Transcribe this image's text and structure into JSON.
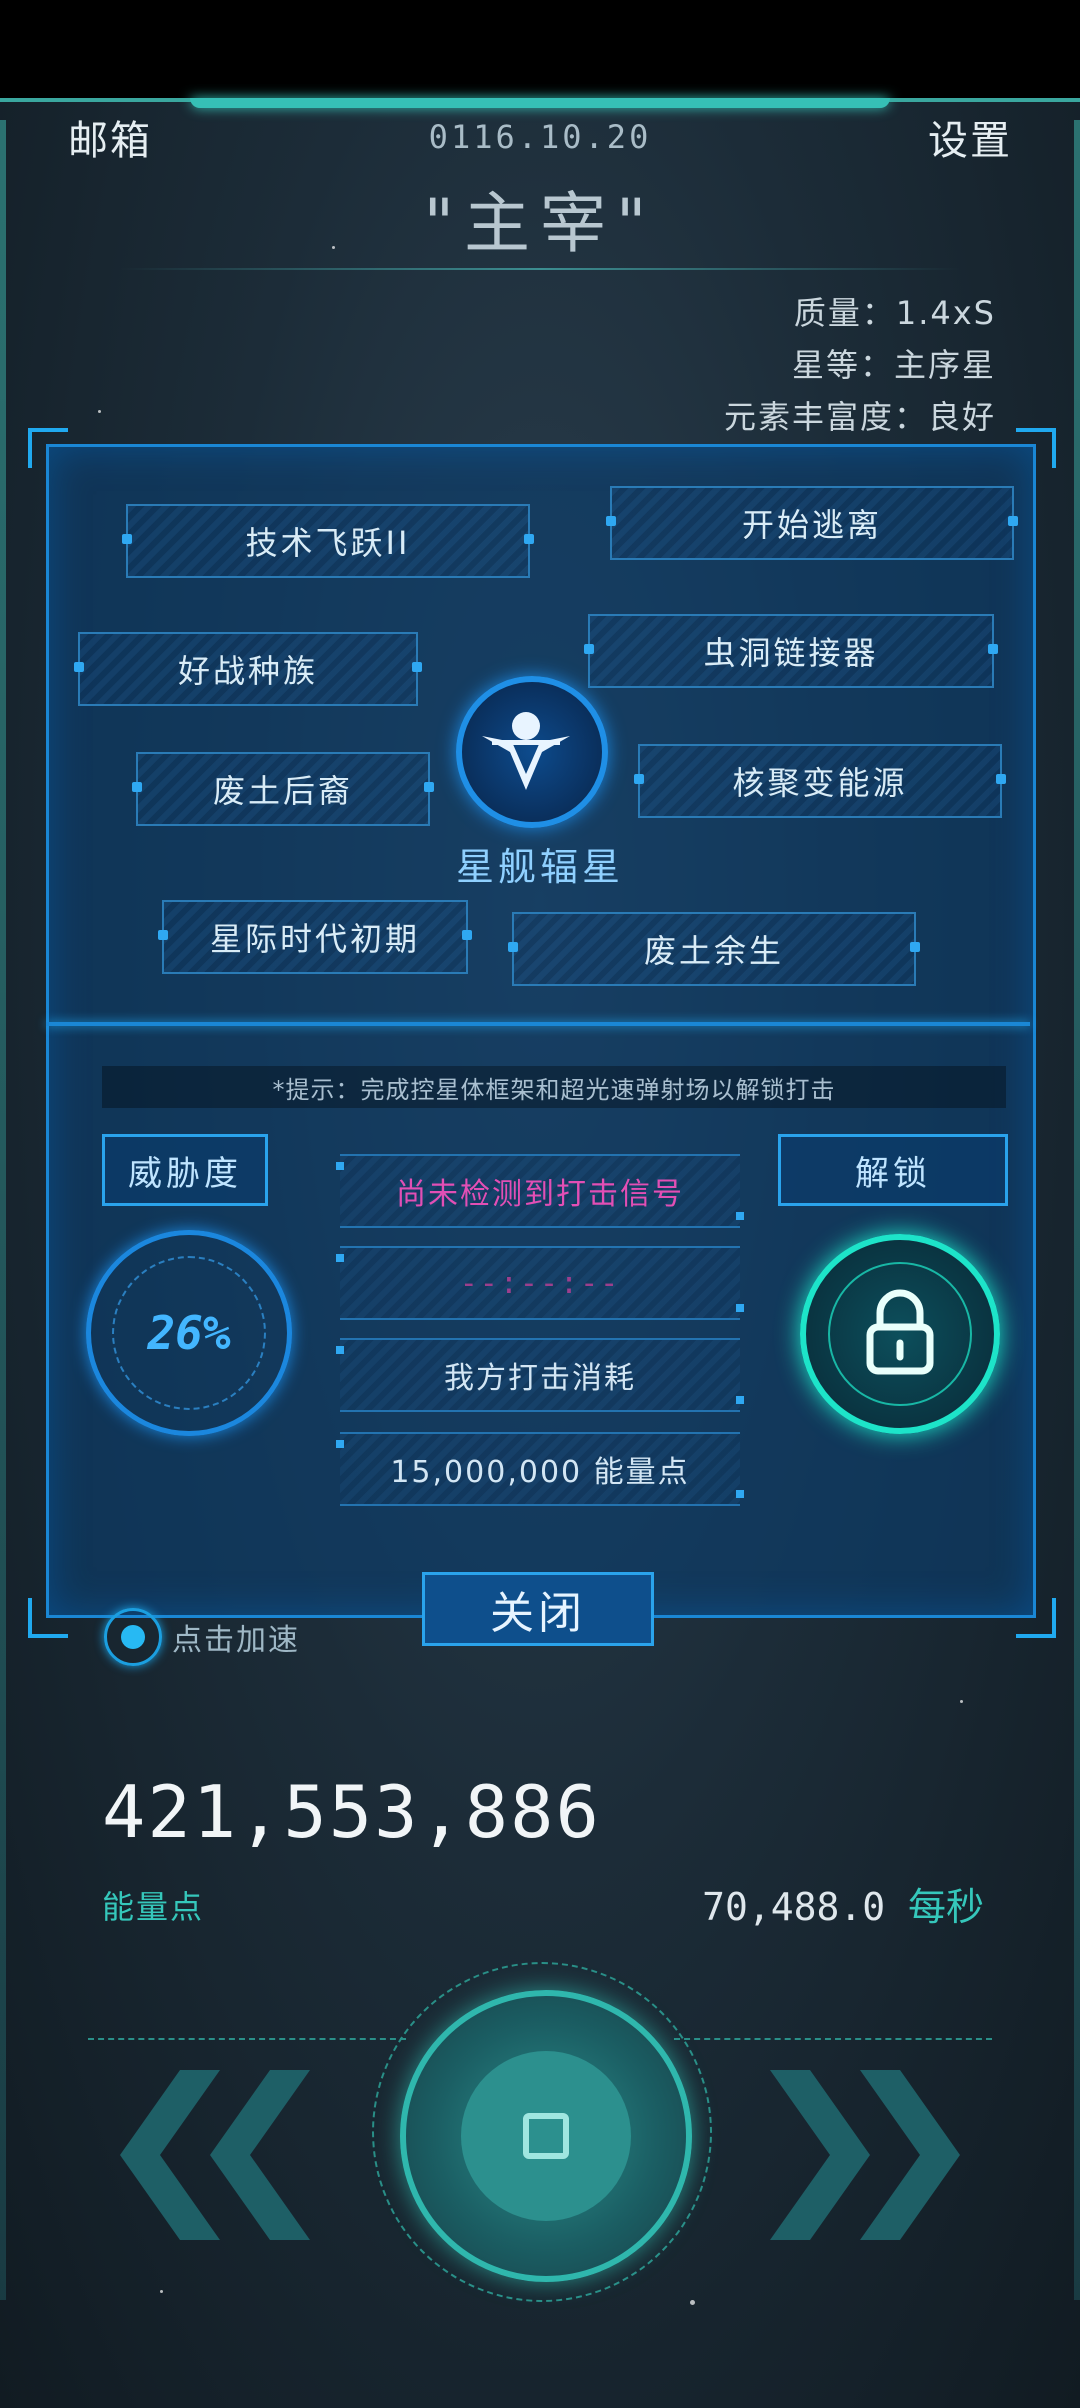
{
  "header": {
    "mailbox_label": "邮箱",
    "date": "0116.10.20",
    "settings_label": "设置",
    "title": "\"主宰\""
  },
  "star_stats": {
    "mass": "质量：1.4xS",
    "class": "星等：主序星",
    "abundance": "元素丰富度：良好"
  },
  "tech_tree": {
    "items": [
      "技术飞跃II",
      "开始逃离",
      "好战种族",
      "虫洞链接器",
      "废土后裔",
      "核聚变能源",
      "星际时代初期",
      "废土余生"
    ],
    "ship_name": "星舰辐星"
  },
  "strike": {
    "hint": "*提示：完成控星体框架和超光速弹射场以解锁打击",
    "threat_label": "威胁度",
    "threat_value": "26%",
    "unlock_label": "解锁",
    "signal_status": "尚未检测到打击信号",
    "timer": "--:--:--",
    "cost_label": "我方打击消耗",
    "cost_value": "15,000,000 能量点"
  },
  "close_label": "关闭",
  "speedup_label": "点击加速",
  "resources": {
    "energy_value": "421,553,886",
    "energy_label": "能量点",
    "rate_value": "70,488.0",
    "rate_unit": "每秒"
  },
  "colors": {
    "accent_teal": "#35c7bb",
    "accent_blue": "#2aa3ec",
    "signal_pink": "#e24fb5",
    "panel_bg": "#0b3f70"
  },
  "icons": {
    "lock": "lock-icon",
    "emblem": "ship-emblem-icon",
    "rewind": "double-chevron-left-icon",
    "forward": "double-chevron-right-icon"
  }
}
